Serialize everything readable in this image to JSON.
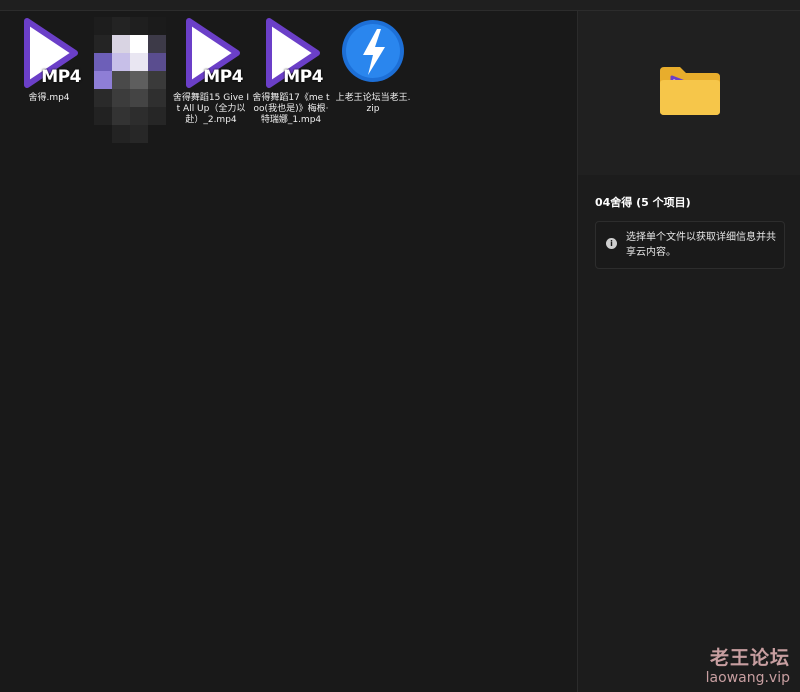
{
  "files": [
    {
      "name": "舍得.mp4",
      "type": "video",
      "badge": "MP4"
    },
    {
      "name": "",
      "type": "image-blurred"
    },
    {
      "name": "舍得舞蹈15 Give It All Up（全力以赴）_2.mp4",
      "type": "video",
      "badge": "MP4"
    },
    {
      "name": "舍得舞蹈17《me too(我也是)》梅根·特瑞娜_1.mp4",
      "type": "video",
      "badge": "MP4"
    },
    {
      "name": "上老王论坛当老王.zip",
      "type": "archive"
    }
  ],
  "details": {
    "title": "04舍得 (5 个项目)",
    "info_text": "选择单个文件以获取详细信息并共享云内容。"
  },
  "watermark": {
    "cn": "老王论坛",
    "en": "laowang.vip"
  },
  "colors": {
    "play_purple": "#6b3fc8",
    "play_white": "#ffffff",
    "zip_blue": "#1d6fd6",
    "folder_yellow": "#f6c64a"
  }
}
